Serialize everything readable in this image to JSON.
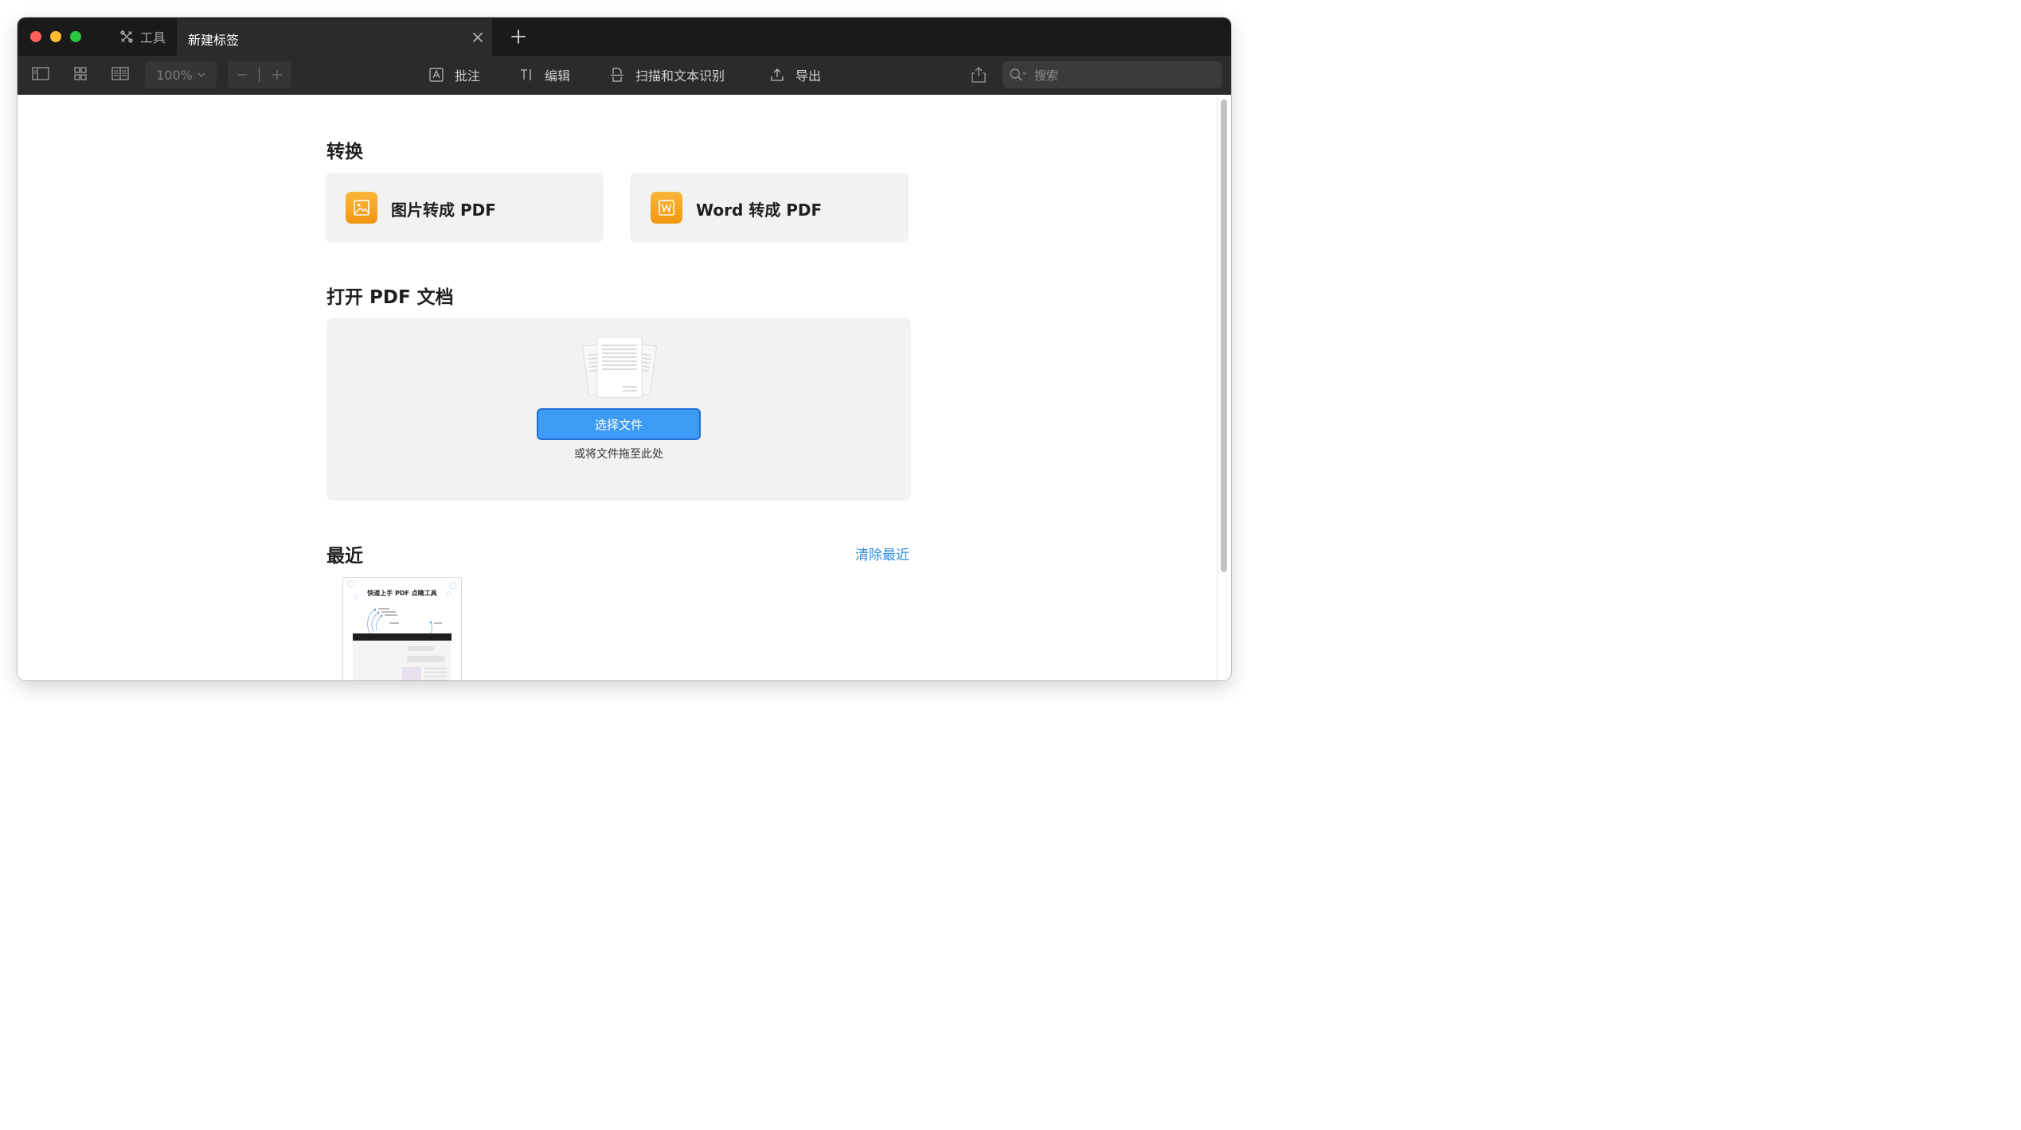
{
  "tabbar": {
    "tools_tab_label": "工具",
    "active_tab_title": "新建标签"
  },
  "toolbar": {
    "zoom_level": "100%",
    "annotate_label": "批注",
    "edit_label": "编辑",
    "scan_ocr_label": "扫描和文本识别",
    "export_label": "导出",
    "search_placeholder": "搜索"
  },
  "convert": {
    "title": "转换",
    "image_to_pdf_label": "图片转成 PDF",
    "word_to_pdf_label": "Word 转成 PDF"
  },
  "open_pdf": {
    "title": "打开 PDF 文档",
    "choose_file_label": "选择文件",
    "drop_hint": "或将文件拖至此处"
  },
  "recent": {
    "title": "最近",
    "clear_label": "清除最近",
    "items": [
      {
        "thumbnail_title": "快速上手 PDF 点睛工具"
      }
    ]
  },
  "colors": {
    "accent_blue": "#3e9bf5",
    "link_blue": "#2f8de4",
    "icon_orange": "#f7a11a",
    "titlebar_dark": "#1a1a1a",
    "toolbar_dark": "#2b2b2b"
  }
}
